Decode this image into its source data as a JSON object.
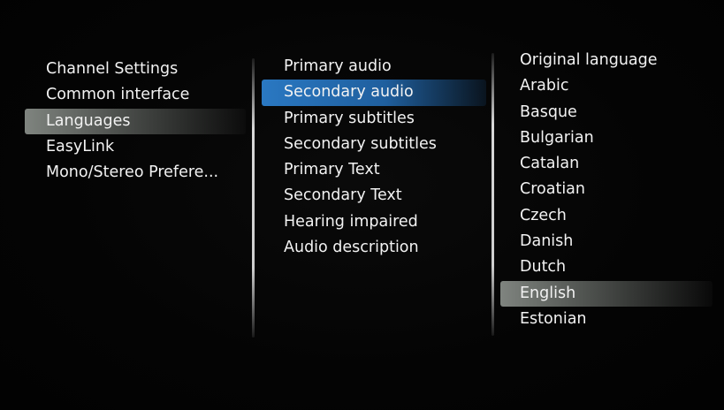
{
  "menu_level1": {
    "items": [
      {
        "label": "Channel Settings"
      },
      {
        "label": "Common interface"
      },
      {
        "label": "Languages"
      },
      {
        "label": "EasyLink"
      },
      {
        "label": "Mono/Stereo Prefere..."
      }
    ],
    "selected_index": 2
  },
  "menu_level2": {
    "items": [
      {
        "label": "Primary audio"
      },
      {
        "label": "Secondary audio"
      },
      {
        "label": "Primary subtitles"
      },
      {
        "label": "Secondary subtitles"
      },
      {
        "label": "Primary Text"
      },
      {
        "label": "Secondary Text"
      },
      {
        "label": "Hearing impaired"
      },
      {
        "label": "Audio description"
      }
    ],
    "focused_index": 1
  },
  "menu_level3": {
    "items": [
      {
        "label": "Original language"
      },
      {
        "label": "Arabic"
      },
      {
        "label": "Basque"
      },
      {
        "label": "Bulgarian"
      },
      {
        "label": "Catalan"
      },
      {
        "label": "Croatian"
      },
      {
        "label": "Czech"
      },
      {
        "label": "Danish"
      },
      {
        "label": "Dutch"
      },
      {
        "label": "English"
      },
      {
        "label": "Estonian"
      }
    ],
    "selected_index": 9
  },
  "colors": {
    "background": "#030303",
    "text": "#f2f2f2",
    "focus_highlight": "#2a78c2",
    "selection_highlight": "#7f847f"
  }
}
